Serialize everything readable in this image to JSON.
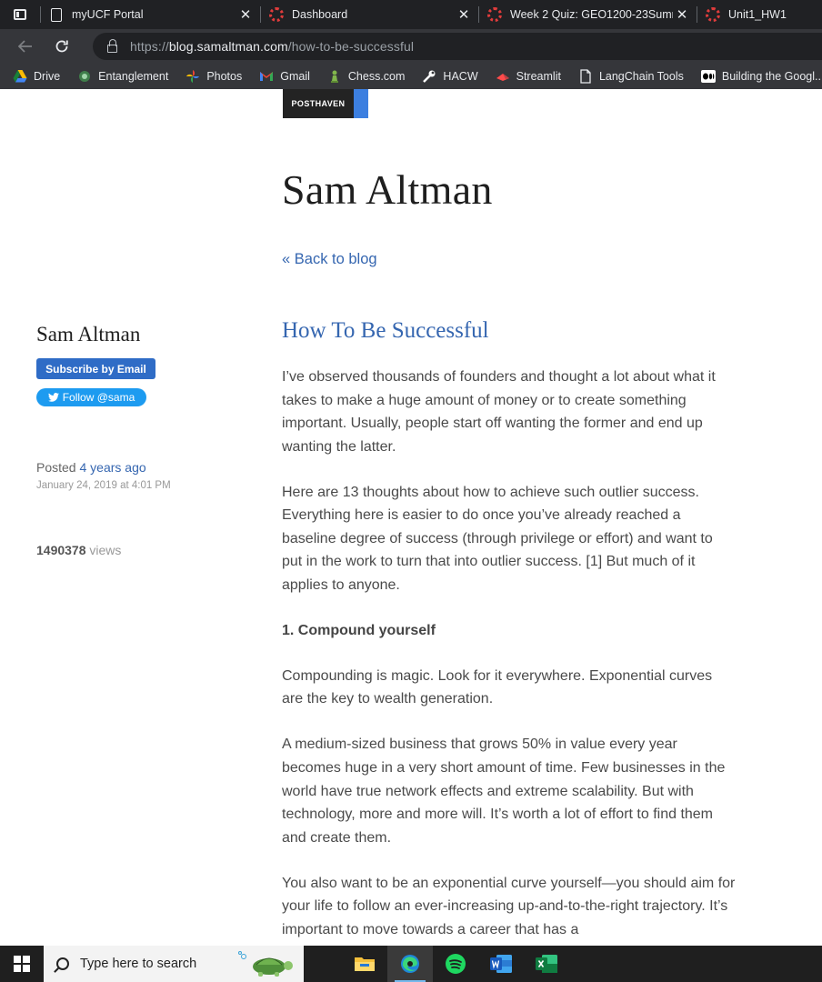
{
  "browser": {
    "tabs": [
      {
        "label": "myUCF Portal",
        "favicon": "document-icon"
      },
      {
        "label": "Dashboard",
        "favicon": "canvas-icon"
      },
      {
        "label": "Week 2 Quiz: GEO1200-23Summ",
        "favicon": "canvas-icon"
      },
      {
        "label": "Unit1_HW1",
        "favicon": "canvas-icon"
      }
    ],
    "url_scheme": "https://",
    "url_host": "blog.samaltman.com",
    "url_path": "/how-to-be-successful",
    "bookmarks": [
      {
        "label": "Drive",
        "icon": "drive-icon"
      },
      {
        "label": "Entanglement",
        "icon": "entanglement-icon"
      },
      {
        "label": "Photos",
        "icon": "photos-icon"
      },
      {
        "label": "Gmail",
        "icon": "gmail-icon"
      },
      {
        "label": "Chess.com",
        "icon": "chess-icon"
      },
      {
        "label": "HACW",
        "icon": "wrench-icon"
      },
      {
        "label": "Streamlit",
        "icon": "streamlit-icon"
      },
      {
        "label": "LangChain Tools",
        "icon": "document-icon"
      },
      {
        "label": "Building the Googl...",
        "icon": "medium-icon"
      }
    ]
  },
  "page": {
    "posthaven_label": "POSTHAVEN",
    "site_title": "Sam Altman",
    "back_link": "« Back to blog",
    "sidebar": {
      "author": "Sam Altman",
      "subscribe_label": "Subscribe by Email",
      "follow_label": "Follow @sama",
      "posted_prefix": "Posted",
      "posted_relative": "4 years ago",
      "posted_date": "January 24, 2019 at 4:01 PM",
      "views_count": "1490378",
      "views_label": "views"
    },
    "post": {
      "title": "How To Be Successful",
      "paragraphs": [
        "I’ve observed thousands of founders and thought a lot about what it takes to make a huge amount of money or to create something important. Usually, people start off wanting the former and end up wanting the latter.",
        "Here are 13 thoughts about how to achieve such outlier success. Everything here is easier to do once you’ve already reached a baseline degree of success (through privilege or effort) and want to put in the work to turn that into outlier success. [1] But much of it applies to anyone.",
        "1. Compound yourself",
        "Compounding is magic. Look for it everywhere. Exponential curves are the key to wealth generation.",
        "A medium-sized business that grows 50% in value every year becomes huge in a very short amount of time. Few businesses in the world have true network effects and extreme scalability. But with technology, more and more will.  It’s worth a lot of effort to find them and create them.",
        "You also want to be an exponential curve yourself—you should aim for your life to follow an ever-increasing up-and-to-the-right trajectory. It’s important to move towards a career that has a"
      ]
    }
  },
  "taskbar": {
    "search_placeholder": "Type here to search",
    "apps": [
      "file-explorer-icon",
      "edge-icon",
      "spotify-icon",
      "word-icon",
      "excel-icon"
    ]
  },
  "colors": {
    "link": "#3566b0",
    "subscribe": "#2f6cc6",
    "twitter": "#1d9bf0",
    "chrome_dark": "#202124"
  }
}
